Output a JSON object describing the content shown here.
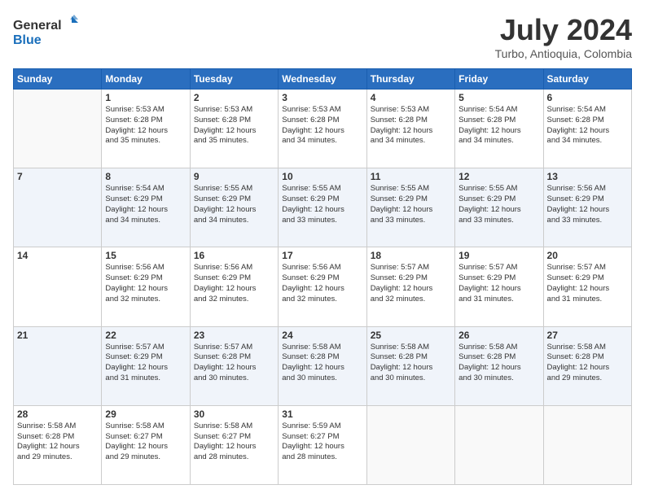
{
  "logo": {
    "line1": "General",
    "line2": "Blue"
  },
  "title": "July 2024",
  "subtitle": "Turbo, Antioquia, Colombia",
  "days_header": [
    "Sunday",
    "Monday",
    "Tuesday",
    "Wednesday",
    "Thursday",
    "Friday",
    "Saturday"
  ],
  "weeks": [
    [
      {
        "day": "",
        "info": ""
      },
      {
        "day": "1",
        "info": "Sunrise: 5:53 AM\nSunset: 6:28 PM\nDaylight: 12 hours\nand 35 minutes."
      },
      {
        "day": "2",
        "info": "Sunrise: 5:53 AM\nSunset: 6:28 PM\nDaylight: 12 hours\nand 35 minutes."
      },
      {
        "day": "3",
        "info": "Sunrise: 5:53 AM\nSunset: 6:28 PM\nDaylight: 12 hours\nand 34 minutes."
      },
      {
        "day": "4",
        "info": "Sunrise: 5:53 AM\nSunset: 6:28 PM\nDaylight: 12 hours\nand 34 minutes."
      },
      {
        "day": "5",
        "info": "Sunrise: 5:54 AM\nSunset: 6:28 PM\nDaylight: 12 hours\nand 34 minutes."
      },
      {
        "day": "6",
        "info": "Sunrise: 5:54 AM\nSunset: 6:28 PM\nDaylight: 12 hours\nand 34 minutes."
      }
    ],
    [
      {
        "day": "7",
        "info": ""
      },
      {
        "day": "8",
        "info": "Sunrise: 5:54 AM\nSunset: 6:29 PM\nDaylight: 12 hours\nand 34 minutes."
      },
      {
        "day": "9",
        "info": "Sunrise: 5:55 AM\nSunset: 6:29 PM\nDaylight: 12 hours\nand 34 minutes."
      },
      {
        "day": "10",
        "info": "Sunrise: 5:55 AM\nSunset: 6:29 PM\nDaylight: 12 hours\nand 33 minutes."
      },
      {
        "day": "11",
        "info": "Sunrise: 5:55 AM\nSunset: 6:29 PM\nDaylight: 12 hours\nand 33 minutes."
      },
      {
        "day": "12",
        "info": "Sunrise: 5:55 AM\nSunset: 6:29 PM\nDaylight: 12 hours\nand 33 minutes."
      },
      {
        "day": "13",
        "info": "Sunrise: 5:56 AM\nSunset: 6:29 PM\nDaylight: 12 hours\nand 33 minutes."
      }
    ],
    [
      {
        "day": "14",
        "info": ""
      },
      {
        "day": "15",
        "info": "Sunrise: 5:56 AM\nSunset: 6:29 PM\nDaylight: 12 hours\nand 32 minutes."
      },
      {
        "day": "16",
        "info": "Sunrise: 5:56 AM\nSunset: 6:29 PM\nDaylight: 12 hours\nand 32 minutes."
      },
      {
        "day": "17",
        "info": "Sunrise: 5:56 AM\nSunset: 6:29 PM\nDaylight: 12 hours\nand 32 minutes."
      },
      {
        "day": "18",
        "info": "Sunrise: 5:57 AM\nSunset: 6:29 PM\nDaylight: 12 hours\nand 32 minutes."
      },
      {
        "day": "19",
        "info": "Sunrise: 5:57 AM\nSunset: 6:29 PM\nDaylight: 12 hours\nand 31 minutes."
      },
      {
        "day": "20",
        "info": "Sunrise: 5:57 AM\nSunset: 6:29 PM\nDaylight: 12 hours\nand 31 minutes."
      }
    ],
    [
      {
        "day": "21",
        "info": ""
      },
      {
        "day": "22",
        "info": "Sunrise: 5:57 AM\nSunset: 6:29 PM\nDaylight: 12 hours\nand 31 minutes."
      },
      {
        "day": "23",
        "info": "Sunrise: 5:57 AM\nSunset: 6:28 PM\nDaylight: 12 hours\nand 30 minutes."
      },
      {
        "day": "24",
        "info": "Sunrise: 5:58 AM\nSunset: 6:28 PM\nDaylight: 12 hours\nand 30 minutes."
      },
      {
        "day": "25",
        "info": "Sunrise: 5:58 AM\nSunset: 6:28 PM\nDaylight: 12 hours\nand 30 minutes."
      },
      {
        "day": "26",
        "info": "Sunrise: 5:58 AM\nSunset: 6:28 PM\nDaylight: 12 hours\nand 30 minutes."
      },
      {
        "day": "27",
        "info": "Sunrise: 5:58 AM\nSunset: 6:28 PM\nDaylight: 12 hours\nand 29 minutes."
      }
    ],
    [
      {
        "day": "28",
        "info": "Sunrise: 5:58 AM\nSunset: 6:28 PM\nDaylight: 12 hours\nand 29 minutes."
      },
      {
        "day": "29",
        "info": "Sunrise: 5:58 AM\nSunset: 6:27 PM\nDaylight: 12 hours\nand 29 minutes."
      },
      {
        "day": "30",
        "info": "Sunrise: 5:58 AM\nSunset: 6:27 PM\nDaylight: 12 hours\nand 28 minutes."
      },
      {
        "day": "31",
        "info": "Sunrise: 5:59 AM\nSunset: 6:27 PM\nDaylight: 12 hours\nand 28 minutes."
      },
      {
        "day": "",
        "info": ""
      },
      {
        "day": "",
        "info": ""
      },
      {
        "day": "",
        "info": ""
      }
    ]
  ]
}
